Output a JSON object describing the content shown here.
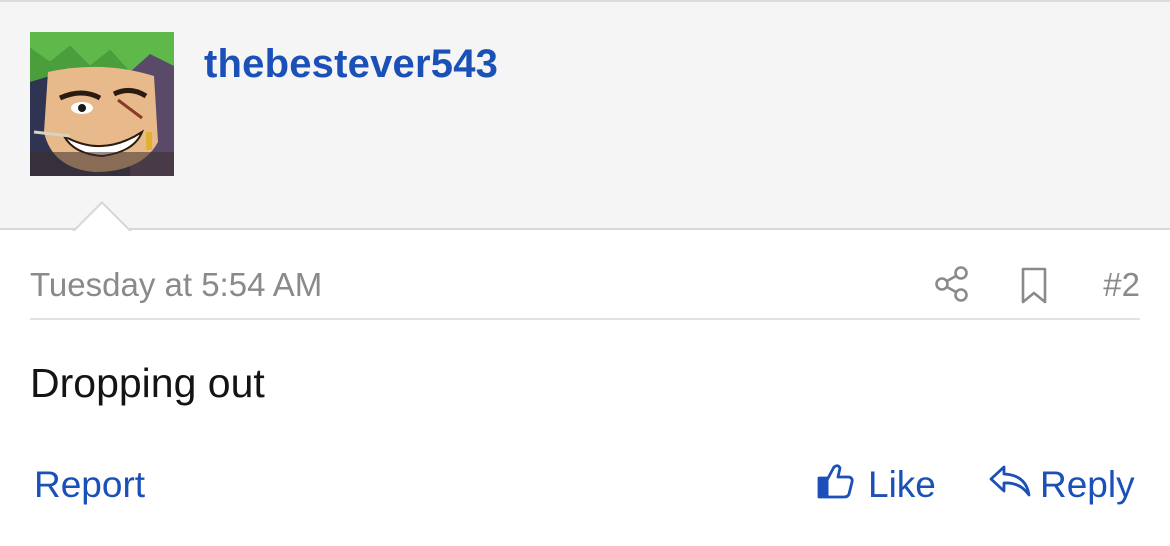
{
  "post": {
    "author": {
      "username": "thebestever543",
      "avatar_icon": "user-avatar"
    },
    "timestamp": "Tuesday at 5:54 AM",
    "post_number": "#2",
    "content": "Dropping out",
    "actions": {
      "share_icon": "share-icon",
      "bookmark_icon": "bookmark-icon",
      "report_label": "Report",
      "like_label": "Like",
      "reply_label": "Reply"
    }
  },
  "colors": {
    "link": "#1a50b8",
    "muted": "#8a8a8a",
    "header_bg": "#f5f5f5",
    "body_text": "#141414"
  }
}
